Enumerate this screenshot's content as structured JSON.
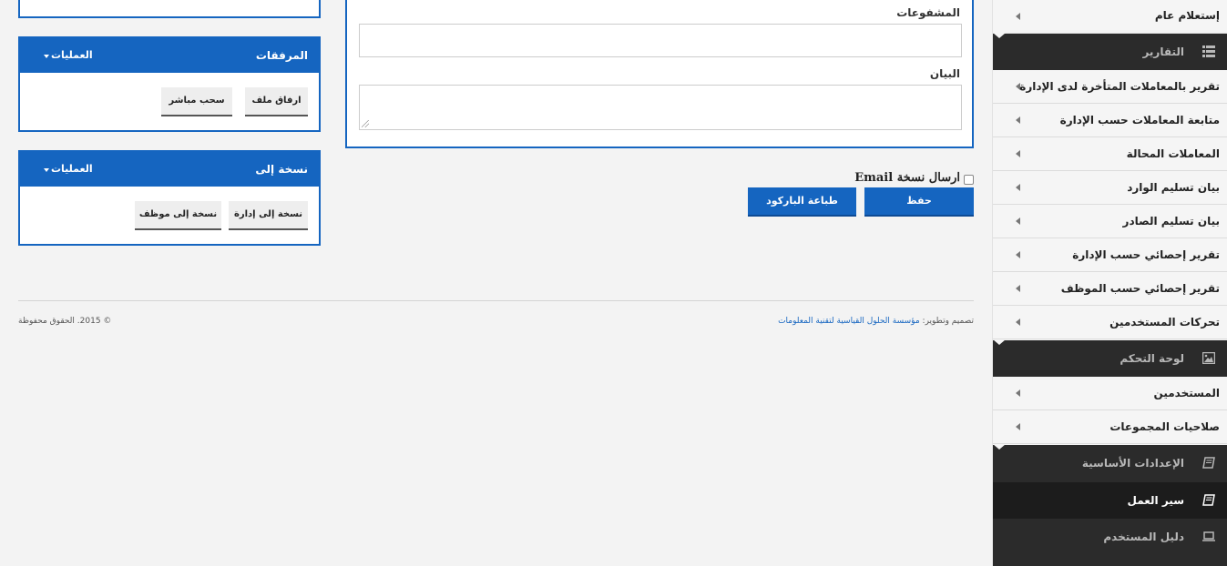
{
  "sidebar": {
    "top_item": "إستعلام عام",
    "reports_header": "التقارير",
    "report_items": [
      "تقرير بالمعاملات المتأخرة لدى الإدارة",
      "متابعة المعاملات حسب الإدارة",
      "المعاملات المحالة",
      "بيان تسليم الوارد",
      "بيان تسليم الصادر",
      "تقرير إحصائي حسب الإدارة",
      "تقرير إحصائي حسب الموظف",
      "تحركات المستخدمين"
    ],
    "dashboard_header": "لوحة التحكم",
    "dashboard_items": [
      "المستخدمين",
      "صلاحيات المجموعات"
    ],
    "settings_header": "الإعدادات الأساسية",
    "workflow_header": "سير العمل",
    "manual_header": "دليل المستخدم"
  },
  "form": {
    "attachments_label": "المشفوعات",
    "attachments_value": "",
    "statement_label": "البيان",
    "statement_value": "",
    "send_email_label": "ارسال نسخة Email",
    "save_button": "حفظ",
    "print_barcode_button": "طباعة الباركود"
  },
  "attachments_panel": {
    "title": "المرفقات",
    "operations": "العمليات",
    "attach_file_button": "ارفاق ملف",
    "direct_scan_button": "سحب مباشر"
  },
  "copy_panel": {
    "title": "نسخة إلى",
    "operations": "العمليات",
    "copy_to_department_button": "نسخة إلى إدارة",
    "copy_to_employee_button": "نسخة إلى موظف"
  },
  "footer": {
    "design_prefix": "تصميم وتطوير:",
    "company": "مؤسسة الحلول القياسية لتقنية المعلومات",
    "copyright": "© 2015. الحقوق محفوظة"
  },
  "colors": {
    "accent": "#1565c0",
    "sidebar_dark": "#2b2b2b"
  }
}
